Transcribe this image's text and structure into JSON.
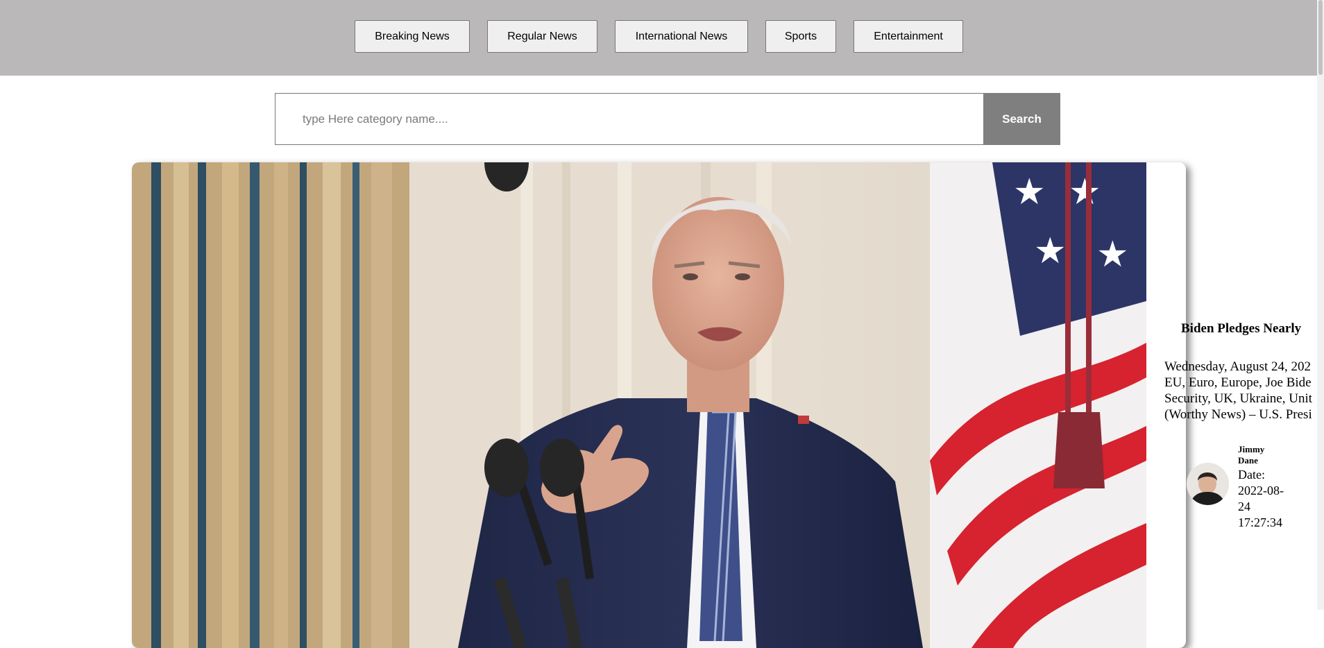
{
  "nav": {
    "items": [
      {
        "label": "Breaking News"
      },
      {
        "label": "Regular News"
      },
      {
        "label": "International News"
      },
      {
        "label": "Sports"
      },
      {
        "label": "Entertainment"
      }
    ]
  },
  "search": {
    "placeholder": "type Here category name....",
    "value": "",
    "button_label": "Search"
  },
  "article": {
    "headline": "Biden Pledges Nearly",
    "excerpt_lines": [
      "Wednesday, August 24, 202",
      "EU, Euro, Europe, Joe Bide",
      "Security, UK, Ukraine, Unit",
      "(Worthy News) – U.S. Presi"
    ],
    "author": {
      "name": "Jimmy Dane",
      "date": "Date: 2022-08-24 17:27:34"
    }
  },
  "colors": {
    "nav_bg": "#bab8b9",
    "button_bg": "#efefef",
    "search_button_bg": "#7f7f7f"
  }
}
